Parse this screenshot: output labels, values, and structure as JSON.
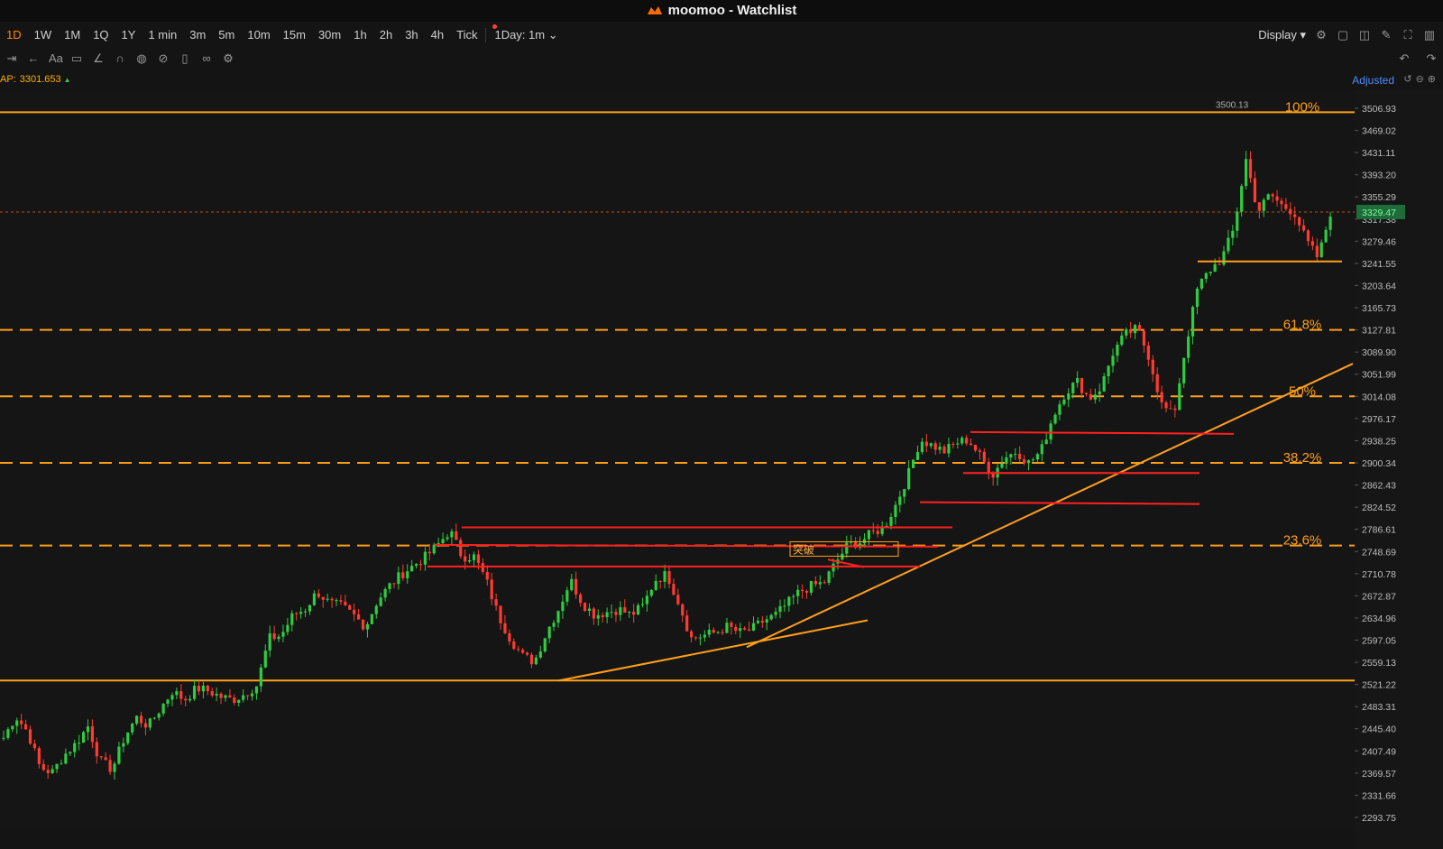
{
  "window": {
    "app": "moomoo",
    "title": "moomoo - Watchlist"
  },
  "timeframes": [
    {
      "label": "1D",
      "active": true
    },
    {
      "label": "1W"
    },
    {
      "label": "1M"
    },
    {
      "label": "1Q"
    },
    {
      "label": "1Y"
    },
    {
      "label": "1 min"
    },
    {
      "label": "3m"
    },
    {
      "label": "5m"
    },
    {
      "label": "10m"
    },
    {
      "label": "15m"
    },
    {
      "label": "30m"
    },
    {
      "label": "1h"
    },
    {
      "label": "2h"
    },
    {
      "label": "3h"
    },
    {
      "label": "4h"
    },
    {
      "label": "Tick"
    }
  ],
  "session_select": "1Day: 1m",
  "toolbar": {
    "display_label": "Display"
  },
  "drawing_tools": [
    "range-icon",
    "arrow-back-icon",
    "text-icon",
    "comment-icon",
    "line-icon",
    "magnet-icon",
    "lock-draw-icon",
    "hide-icon",
    "trash-icon",
    "link-icon",
    "settings-icon"
  ],
  "indicator": {
    "label": "AP:",
    "value": "3301.653"
  },
  "adjust_label": "Adjusted",
  "colors": {
    "up": "#2ecc40",
    "down": "#ff3b30",
    "fib": "#ff9f1a",
    "trend": "#ff9f1a",
    "box": "#ff2020",
    "accent": "#ff8a00"
  },
  "chart_data": {
    "type": "candlestick",
    "price_axis_labels": [
      "3506.93",
      "3469.02",
      "3431.11",
      "3393.20",
      "3355.29",
      "3317.38",
      "3279.46",
      "3241.55",
      "3203.64",
      "3165.73",
      "3127.81",
      "3089.90",
      "3051.99",
      "3014.08",
      "2976.17",
      "2938.25",
      "2900.34",
      "2862.43",
      "2824.52",
      "2786.61",
      "2748.69",
      "2710.78",
      "2672.87",
      "2634.96",
      "2597.05",
      "2559.13",
      "2521.22",
      "2483.31",
      "2445.40",
      "2407.49",
      "2369.57",
      "2331.66",
      "2293.75"
    ],
    "ylim": [
      2293.75,
      3506.93
    ],
    "last_price": "3329.47",
    "high_label": "3500.13",
    "fib_levels": [
      {
        "label": "100%",
        "price": 3500.13,
        "style": "solid"
      },
      {
        "label": "61.8%",
        "price": 3127.81,
        "style": "dashed"
      },
      {
        "label": "50%",
        "price": 3014.08,
        "style": "dashed"
      },
      {
        "label": "38.2%",
        "price": 2900.34,
        "style": "dashed"
      },
      {
        "label": "23.6%",
        "price": 2759.0,
        "style": "dashed"
      },
      {
        "label": "",
        "price": 2528.0,
        "style": "solid"
      }
    ],
    "annotation": "突破",
    "anchor_closes": [
      2430,
      2467,
      2440,
      2380,
      2370,
      2400,
      2420,
      2450,
      2390,
      2376,
      2430,
      2465,
      2450,
      2480,
      2510,
      2495,
      2515,
      2510,
      2500,
      2495,
      2505,
      2520,
      2600,
      2605,
      2640,
      2650,
      2680,
      2660,
      2655,
      2640,
      2620,
      2665,
      2690,
      2710,
      2725,
      2740,
      2760,
      2785,
      2740,
      2740,
      2700,
      2640,
      2600,
      2570,
      2560,
      2610,
      2650,
      2700,
      2660,
      2640,
      2645,
      2650,
      2640,
      2655,
      2700,
      2710,
      2660,
      2600,
      2605,
      2610,
      2620,
      2610,
      2615,
      2630,
      2640,
      2660,
      2680,
      2690,
      2695,
      2730,
      2760,
      2765,
      2780,
      2790,
      2830,
      2880,
      2940,
      2930,
      2920,
      2935,
      2940,
      2910,
      2880,
      2910,
      2920,
      2900,
      2920,
      2980,
      3020,
      3040,
      3010,
      3030,
      3090,
      3120,
      3130,
      3080,
      3000,
      2980,
      3100,
      3200,
      3230,
      3250,
      3300,
      3420,
      3330,
      3360,
      3340,
      3330,
      3280,
      3250,
      3329
    ]
  }
}
